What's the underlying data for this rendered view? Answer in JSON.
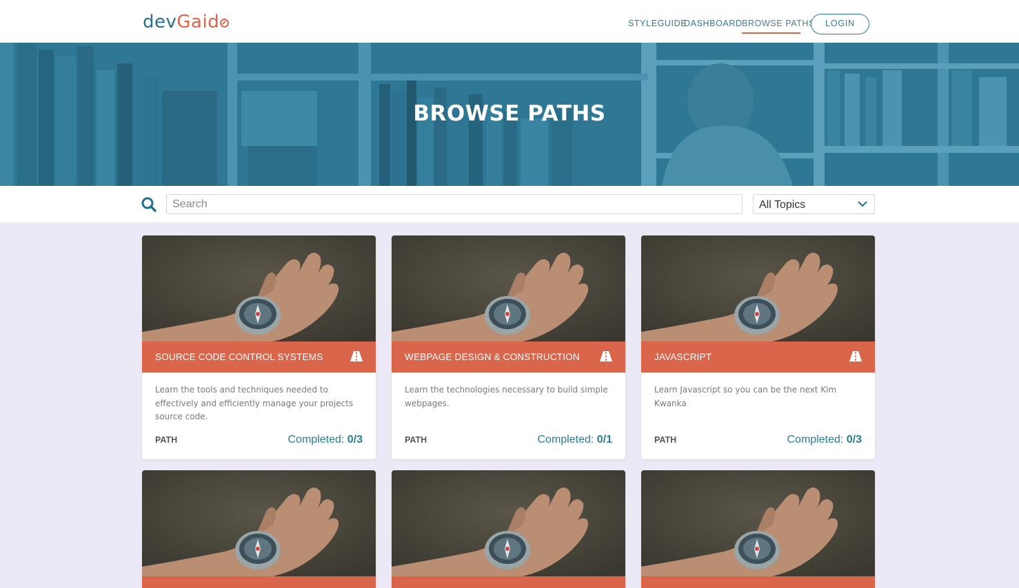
{
  "header": {
    "logo_dev": "dev",
    "logo_gaido": "Gaid",
    "nav": [
      "STYLEGUIDE",
      "DASHBOARD",
      "BROWSE PATHS"
    ],
    "login_label": "LOGIN"
  },
  "hero": {
    "title": "BROWSE PATHS"
  },
  "search": {
    "placeholder": "Search",
    "topic_selected": "All Topics"
  },
  "colors": {
    "accent": "#d9654a",
    "primary": "#2a7c96",
    "hero": "#2f7895",
    "page_bg": "#eae9f5"
  },
  "cards": [
    {
      "title": "SOURCE CODE CONTROL SYSTEMS",
      "description": "Learn the tools and techniques needed to effectively and efficiently manage your projects source code.",
      "type": "PATH",
      "progress_label": "Completed: ",
      "progress_value": "0/3",
      "icon": "road-icon"
    },
    {
      "title": "WEBPAGE DESIGN & CONSTRUCTION",
      "description": "Learn the technologies necessary to build simple webpages.",
      "type": "PATH",
      "progress_label": "Completed: ",
      "progress_value": "0/1",
      "icon": "road-icon"
    },
    {
      "title": "JAVASCRIPT",
      "description": "Learn Javascript so you can be the next Kim Kwanka",
      "type": "PATH",
      "progress_label": "Completed: ",
      "progress_value": "0/3",
      "icon": "road-icon"
    }
  ]
}
